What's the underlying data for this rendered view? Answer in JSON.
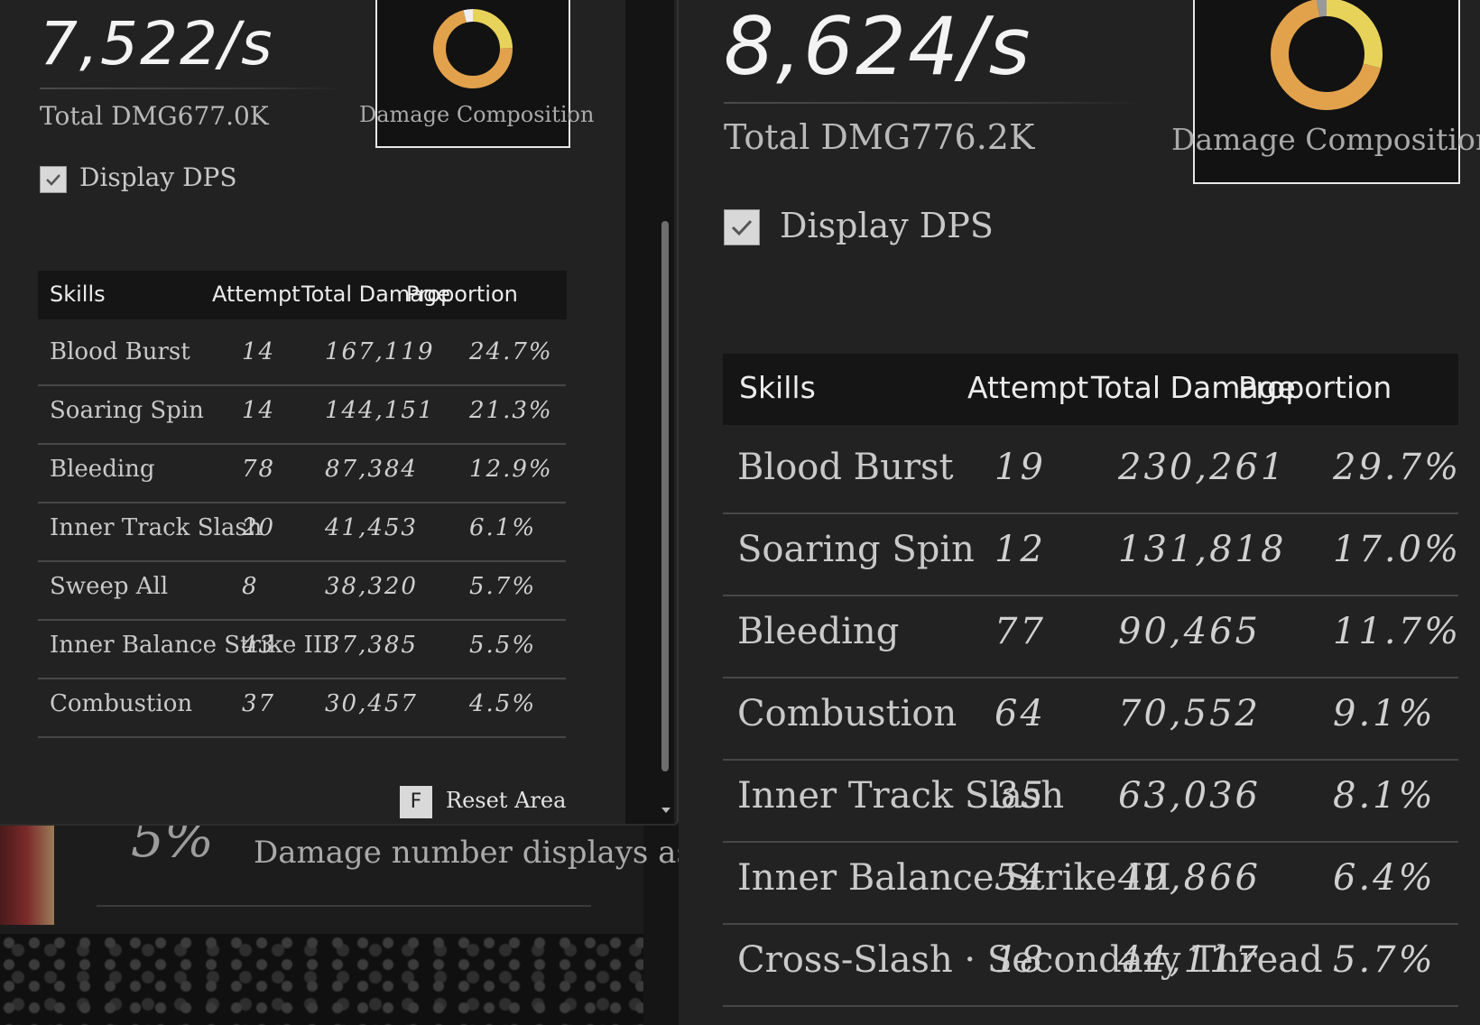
{
  "left": {
    "dps": "7,522/s",
    "total": "Total DMG677.0K",
    "composition_label": "Damage Composition",
    "display_dps_label": "Display DPS",
    "display_dps_checked": true,
    "headers": [
      "Skills",
      "Attempt",
      "Total Damage",
      "Proportion"
    ],
    "rows": [
      {
        "skill": "Blood Burst",
        "attempt": "14",
        "total": "167,119",
        "proportion": "24.7%"
      },
      {
        "skill": "Soaring Spin",
        "attempt": "14",
        "total": "144,151",
        "proportion": "21.3%"
      },
      {
        "skill": "Bleeding",
        "attempt": "78",
        "total": "87,384",
        "proportion": "12.9%"
      },
      {
        "skill": "Inner Track Slash",
        "attempt": "20",
        "total": "41,453",
        "proportion": "6.1%"
      },
      {
        "skill": "Sweep All",
        "attempt": "8",
        "total": "38,320",
        "proportion": "5.7%"
      },
      {
        "skill": "Inner Balance Strike III",
        "attempt": "43",
        "total": "37,385",
        "proportion": "5.5%"
      },
      {
        "skill": "Combustion",
        "attempt": "37",
        "total": "30,457",
        "proportion": "4.5%"
      }
    ],
    "reset_key": "F",
    "reset_label": "Reset Area",
    "donut": [
      {
        "value": 0.247,
        "color": "#e8d35a"
      },
      {
        "value": 0.713,
        "color": "#e2a24c"
      },
      {
        "value": 0.04,
        "color": "#efefef"
      }
    ]
  },
  "background": {
    "big_percent": "5%",
    "note": "Damage number displays as"
  },
  "right": {
    "dps": "8,624/s",
    "total": "Total DMG776.2K",
    "composition_label": "Damage Composition",
    "display_dps_label": "Display DPS",
    "display_dps_checked": true,
    "headers": [
      "Skills",
      "Attempt",
      "Total Damage",
      "Proportion"
    ],
    "rows": [
      {
        "skill": "Blood Burst",
        "attempt": "19",
        "total": "230,261",
        "proportion": "29.7%"
      },
      {
        "skill": "Soaring Spin",
        "attempt": "12",
        "total": "131,818",
        "proportion": "17.0%"
      },
      {
        "skill": "Bleeding",
        "attempt": "77",
        "total": "90,465",
        "proportion": "11.7%"
      },
      {
        "skill": "Combustion",
        "attempt": "64",
        "total": "70,552",
        "proportion": "9.1%"
      },
      {
        "skill": "Inner Track Slash",
        "attempt": "35",
        "total": "63,036",
        "proportion": "8.1%"
      },
      {
        "skill": "Inner Balance Strike III",
        "attempt": "54",
        "total": "49,866",
        "proportion": "6.4%"
      },
      {
        "skill": "Cross-Slash · Secondary Thread",
        "attempt": "18",
        "total": "44,117",
        "proportion": "5.7%"
      }
    ],
    "donut": [
      {
        "value": 0.29,
        "color": "#e8d35a"
      },
      {
        "value": 0.68,
        "color": "#e2a24c"
      },
      {
        "value": 0.03,
        "color": "#9a9a9a"
      }
    ]
  }
}
